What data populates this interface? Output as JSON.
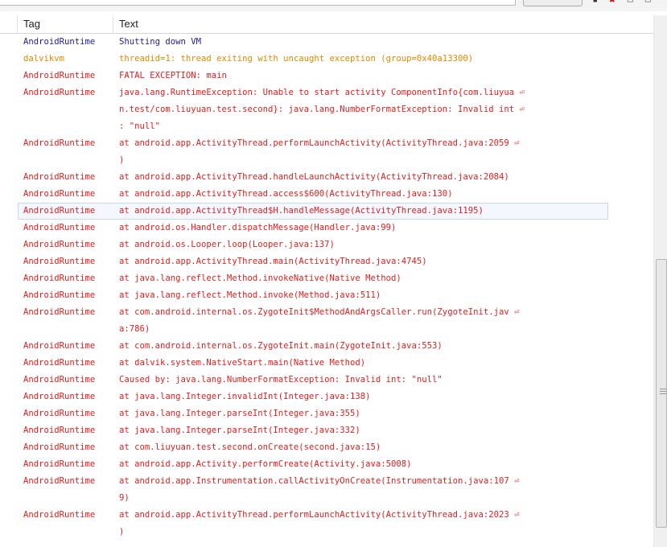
{
  "header": {
    "tag": "Tag",
    "text": "Text"
  },
  "rows": [
    {
      "level": "info",
      "tag": "AndroidRuntime",
      "lines": [
        "Shutting down VM"
      ]
    },
    {
      "level": "warn",
      "tag": "dalvikvm",
      "lines": [
        "threadid=1: thread exiting with uncaught exception (group=0x40a13300)"
      ]
    },
    {
      "level": "error",
      "tag": "AndroidRuntime",
      "lines": [
        "FATAL EXCEPTION: main"
      ]
    },
    {
      "level": "error",
      "tag": "AndroidRuntime",
      "lines": [
        "java.lang.RuntimeException: Unable to start activity ComponentInfo{com.liuyua ⏎",
        "n.test/com.liuyuan.test.second}: java.lang.NumberFormatException: Invalid int ⏎",
        ": \"null\""
      ]
    },
    {
      "level": "error",
      "tag": "AndroidRuntime",
      "lines": [
        "at android.app.ActivityThread.performLaunchActivity(ActivityThread.java:2059 ⏎",
        ")"
      ]
    },
    {
      "level": "error",
      "tag": "AndroidRuntime",
      "lines": [
        "at android.app.ActivityThread.handleLaunchActivity(ActivityThread.java:2084)"
      ]
    },
    {
      "level": "error",
      "tag": "AndroidRuntime",
      "lines": [
        "at android.app.ActivityThread.access$600(ActivityThread.java:130)"
      ]
    },
    {
      "level": "error",
      "tag": "AndroidRuntime",
      "selected": true,
      "lines": [
        "at android.app.ActivityThread$H.handleMessage(ActivityThread.java:1195)"
      ]
    },
    {
      "level": "error",
      "tag": "AndroidRuntime",
      "lines": [
        "at android.os.Handler.dispatchMessage(Handler.java:99)"
      ]
    },
    {
      "level": "error",
      "tag": "AndroidRuntime",
      "lines": [
        "at android.os.Looper.loop(Looper.java:137)"
      ]
    },
    {
      "level": "error",
      "tag": "AndroidRuntime",
      "lines": [
        "at android.app.ActivityThread.main(ActivityThread.java:4745)"
      ]
    },
    {
      "level": "error",
      "tag": "AndroidRuntime",
      "lines": [
        "at java.lang.reflect.Method.invokeNative(Native Method)"
      ]
    },
    {
      "level": "error",
      "tag": "AndroidRuntime",
      "lines": [
        "at java.lang.reflect.Method.invoke(Method.java:511)"
      ]
    },
    {
      "level": "error",
      "tag": "AndroidRuntime",
      "lines": [
        "at com.android.internal.os.ZygoteInit$MethodAndArgsCaller.run(ZygoteInit.jav ⏎",
        "a:786)"
      ]
    },
    {
      "level": "error",
      "tag": "AndroidRuntime",
      "lines": [
        "at com.android.internal.os.ZygoteInit.main(ZygoteInit.java:553)"
      ]
    },
    {
      "level": "error",
      "tag": "AndroidRuntime",
      "lines": [
        "at dalvik.system.NativeStart.main(Native Method)"
      ]
    },
    {
      "level": "error",
      "tag": "AndroidRuntime",
      "lines": [
        "Caused by: java.lang.NumberFormatException: Invalid int: \"null\""
      ]
    },
    {
      "level": "error",
      "tag": "AndroidRuntime",
      "lines": [
        "at java.lang.Integer.invalidInt(Integer.java:138)"
      ]
    },
    {
      "level": "error",
      "tag": "AndroidRuntime",
      "lines": [
        "at java.lang.Integer.parseInt(Integer.java:355)"
      ]
    },
    {
      "level": "error",
      "tag": "AndroidRuntime",
      "lines": [
        "at java.lang.Integer.parseInt(Integer.java:332)"
      ]
    },
    {
      "level": "error",
      "tag": "AndroidRuntime",
      "lines": [
        "at com.liuyuan.test.second.onCreate(second.java:15)"
      ]
    },
    {
      "level": "error",
      "tag": "AndroidRuntime",
      "lines": [
        "at android.app.Activity.performCreate(Activity.java:5008)"
      ]
    },
    {
      "level": "error",
      "tag": "AndroidRuntime",
      "lines": [
        "at android.app.Instrumentation.callActivityOnCreate(Instrumentation.java:107 ⏎",
        "9)"
      ]
    },
    {
      "level": "error",
      "tag": "AndroidRuntime",
      "lines": [
        "at android.app.ActivityThread.performLaunchActivity(ActivityThread.java:2023 ⏎",
        ")"
      ]
    }
  ]
}
